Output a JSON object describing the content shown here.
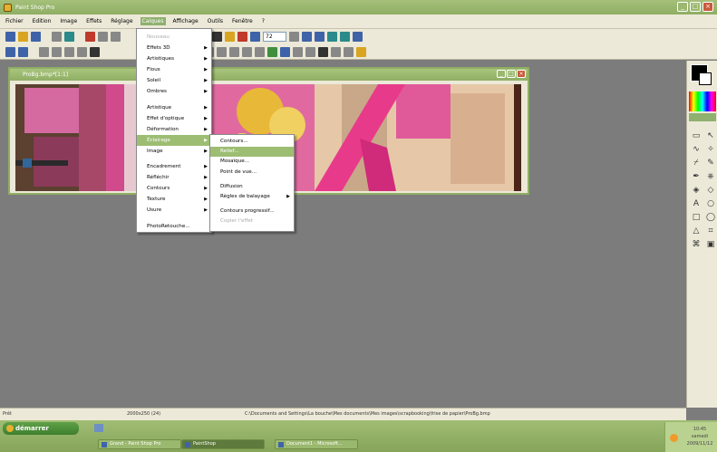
{
  "window": {
    "title": "Paint Shop Pro"
  },
  "menubar": {
    "items": [
      "Fichier",
      "Edition",
      "Image",
      "Effets",
      "Réglage",
      "Calques",
      "Affichage",
      "Outils",
      "Fenêtre",
      "?"
    ],
    "active_index": 5
  },
  "toolbar": {
    "font_size_value": "72"
  },
  "image_window": {
    "title": "ProBg.bmp*[1:1]"
  },
  "dropdown": {
    "items": [
      {
        "label": "Nouveau",
        "disabled": true,
        "arrow": false
      },
      {
        "label": "Effets 3D",
        "disabled": false,
        "arrow": true
      },
      {
        "label": "Artistiques",
        "disabled": false,
        "arrow": true
      },
      {
        "label": "Flous",
        "disabled": false,
        "arrow": true
      },
      {
        "label": "Soleil",
        "disabled": false,
        "arrow": true
      },
      {
        "label": "Ombres",
        "disabled": false,
        "arrow": true
      },
      {
        "label": "",
        "sep": true
      },
      {
        "label": "Artistique",
        "disabled": false,
        "arrow": true
      },
      {
        "label": "Effet d'optique",
        "disabled": false,
        "arrow": true
      },
      {
        "label": "Déformation",
        "disabled": false,
        "arrow": true
      },
      {
        "label": "Éclairage",
        "disabled": false,
        "arrow": true,
        "highlight": true
      },
      {
        "label": "Image",
        "disabled": false,
        "arrow": true
      },
      {
        "label": "",
        "sep": true
      },
      {
        "label": "Encadrement",
        "disabled": false,
        "arrow": true
      },
      {
        "label": "Réfléchir",
        "disabled": false,
        "arrow": true
      },
      {
        "label": "Contours",
        "disabled": false,
        "arrow": true
      },
      {
        "label": "Texture",
        "disabled": false,
        "arrow": true
      },
      {
        "label": "Usure",
        "disabled": false,
        "arrow": true
      },
      {
        "label": "",
        "sep": true
      },
      {
        "label": "PhotoRetouche...",
        "disabled": false,
        "arrow": false
      }
    ]
  },
  "submenu": {
    "items": [
      {
        "label": "Contours...",
        "disabled": false,
        "arrow": false
      },
      {
        "label": "Relief...",
        "disabled": false,
        "arrow": false,
        "highlight": true
      },
      {
        "label": "Mosaïque...",
        "disabled": false,
        "arrow": false
      },
      {
        "label": "Point de vue...",
        "disabled": false,
        "arrow": false
      },
      {
        "label": "",
        "sep": true
      },
      {
        "label": "Diffusion",
        "disabled": false,
        "arrow": false
      },
      {
        "label": "Règles de balayage",
        "disabled": false,
        "arrow": true
      },
      {
        "label": "",
        "sep": true
      },
      {
        "label": "Contours progressif...",
        "disabled": false,
        "arrow": false
      },
      {
        "label": "Copier l'effet",
        "disabled": true,
        "arrow": false
      }
    ]
  },
  "statusbar": {
    "left": "Prêt",
    "middle": "2000x250 (24)",
    "right": "C:\\Documents and Settings\\La bouche\\Mes documents\\Mes images\\scrapbooking\\frise de papier\\ProBg.bmp"
  },
  "taskbar": {
    "start_label": "démarrer",
    "tasks": [
      "Grand - Paint Shop Pro",
      "PaintShop",
      "Document1 - Microsoft..."
    ],
    "active_task": 1,
    "clock": [
      "10:45",
      "samedi",
      "2009/11/12"
    ]
  },
  "colors": {
    "accent_green": "#8fb06f",
    "menu_highlight": "#9dbd73",
    "workspace": "#7c7c7c"
  }
}
